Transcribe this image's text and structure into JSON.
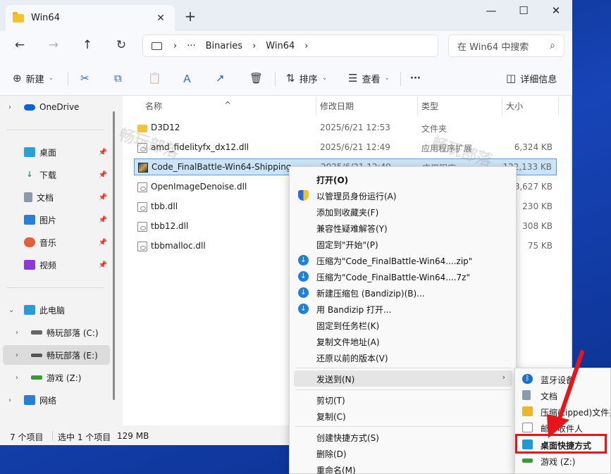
{
  "window": {
    "tab_title": "Win64",
    "tab_close": "✕",
    "new_tab": "+",
    "minimize": "—",
    "maximize": "☐",
    "close": "✕"
  },
  "nav": {
    "back": "←",
    "forward": "→",
    "up": "↑",
    "refresh": "↻",
    "breadcrumb": [
      "›",
      "···",
      "Binaries",
      "›",
      "Win64",
      "›"
    ],
    "search_placeholder": "在 Win64 中搜索",
    "search_icon": "⌕"
  },
  "toolbar": {
    "new_label": "新建",
    "sort_label": "排序",
    "view_label": "查看",
    "more_label": "···",
    "details_label": "详细信息",
    "icons": {
      "new": "⊕",
      "cut": "✂",
      "copy": "⧉",
      "paste": "📋",
      "rename": "Ａ",
      "share": "↗",
      "delete": "🗑",
      "sort": "⇅",
      "view": "☰",
      "details": "◫"
    }
  },
  "sidebar": {
    "items": [
      {
        "label": "OneDrive",
        "icon": "cloud-icon",
        "color": "#0a64d8"
      },
      {
        "label": "桌面",
        "icon": "desktop-icon",
        "color": "#2aa0d8"
      },
      {
        "label": "下载",
        "icon": "download-icon",
        "color": "#1aa06a"
      },
      {
        "label": "文档",
        "icon": "document-icon",
        "color": "#6a7a8c"
      },
      {
        "label": "图片",
        "icon": "pictures-icon",
        "color": "#2a7ed8"
      },
      {
        "label": "音乐",
        "icon": "music-icon",
        "color": "#e0603a"
      },
      {
        "label": "视频",
        "icon": "video-icon",
        "color": "#8a3ad8"
      },
      {
        "label": "此电脑",
        "icon": "pc-icon",
        "color": "#2a9ad8"
      },
      {
        "label": "畅玩部落 (C:)",
        "icon": "drive-icon",
        "color": "#555"
      },
      {
        "label": "畅玩部落 (E:)",
        "icon": "drive-icon",
        "color": "#555"
      },
      {
        "label": "游戏 (Z:)",
        "icon": "drive-icon",
        "color": "#3a9a3a"
      },
      {
        "label": "网络",
        "icon": "network-icon",
        "color": "#2a7ed8"
      }
    ],
    "pin": "📌",
    "caret_right": "›",
    "caret_down": "⌄"
  },
  "columns": {
    "name": "名称",
    "date": "修改日期",
    "type": "类型",
    "size": "大小",
    "sort_indicator": "^"
  },
  "files": [
    {
      "name": "D3D12",
      "date": "2025/6/21 12:53",
      "type": "文件夹",
      "size": "",
      "kind": "folder"
    },
    {
      "name": "amd_fidelityfx_dx12.dll",
      "date": "2025/6/21 12:49",
      "type": "应用程序扩展",
      "size": "6,324 KB",
      "kind": "dll"
    },
    {
      "name": "Code_FinalBattle-Win64-Shipping",
      "date": "2025/6/21 12:49",
      "type": "应用程序",
      "size": "122,133 KB",
      "kind": "exe"
    },
    {
      "name": "OpenImageDenoise.dll",
      "date": "",
      "type": "",
      "size": "8,627 KB",
      "kind": "dll"
    },
    {
      "name": "tbb.dll",
      "date": "",
      "type": "",
      "size": "230 KB",
      "kind": "dll"
    },
    {
      "name": "tbb12.dll",
      "date": "",
      "type": "",
      "size": "308 KB",
      "kind": "dll"
    },
    {
      "name": "tbbmalloc.dll",
      "date": "",
      "type": "",
      "size": "75 KB",
      "kind": "dll"
    }
  ],
  "status": {
    "count": "7 个项目",
    "selected": "选中 1 个项目",
    "size": "129 MB"
  },
  "context_menu": {
    "items": [
      {
        "label": "打开(O)",
        "icon": ""
      },
      {
        "label": "以管理员身份运行(A)",
        "icon": "shield-icon"
      },
      {
        "label": "添加到收藏夹(F)",
        "icon": ""
      },
      {
        "label": "兼容性疑难解答(Y)",
        "icon": ""
      },
      {
        "label": "固定到\"开始\"(P)",
        "icon": ""
      },
      {
        "label": "压缩为\"Code_FinalBattle-Win64....zip\"",
        "icon": "bandizip-icon"
      },
      {
        "label": "压缩为\"Code_FinalBattle-Win64....7z\"",
        "icon": "bandizip-icon"
      },
      {
        "label": "新建压缩包 (Bandizip)(B)...",
        "icon": "bandizip-icon"
      },
      {
        "label": "用 Bandizip 打开...",
        "icon": "bandizip-icon"
      },
      {
        "label": "固定到任务栏(K)",
        "icon": ""
      },
      {
        "label": "复制文件地址(A)",
        "icon": ""
      },
      {
        "label": "还原以前的版本(V)",
        "icon": ""
      },
      {
        "label": "发送到(N)",
        "icon": "",
        "submenu": true
      },
      {
        "label": "剪切(T)",
        "icon": ""
      },
      {
        "label": "复制(C)",
        "icon": ""
      },
      {
        "label": "创建快捷方式(S)",
        "icon": ""
      },
      {
        "label": "删除(D)",
        "icon": ""
      },
      {
        "label": "重命名(M)",
        "icon": ""
      }
    ],
    "submenu_arrow": "›",
    "bz_glyph": "↓"
  },
  "sendto_menu": {
    "items": [
      {
        "label": "蓝牙设备",
        "icon": "bluetooth-icon",
        "color": "#1f6fd0"
      },
      {
        "label": "文档",
        "icon": "document-icon",
        "color": "#6a7a8c"
      },
      {
        "label": "压缩(zipped)文件夹",
        "icon": "zip-folder-icon",
        "color": "#f0b429"
      },
      {
        "label": "邮件收件人",
        "icon": "mail-icon",
        "color": "#8a8a8a"
      },
      {
        "label": "桌面快捷方式",
        "icon": "desktop-shortcut-icon",
        "color": "#1e9ad6"
      },
      {
        "label": "游戏 (Z:)",
        "icon": "drive-icon",
        "color": "#3a9a3a"
      }
    ],
    "bt_glyph": "ᛒ"
  },
  "watermark": {
    "text": "畅玩部落"
  },
  "colors": {
    "highlight_red": "#e8141a",
    "selection": "#cce4f7",
    "accent": "#2a62c9"
  }
}
